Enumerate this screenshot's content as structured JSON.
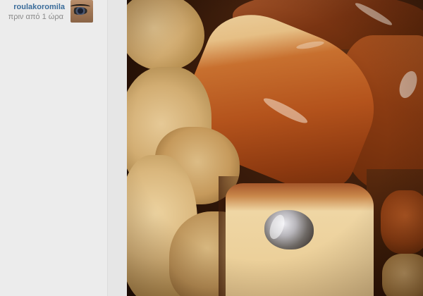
{
  "post": {
    "username": "roulakoromila",
    "timestamp": "πριν από 1 ώρα",
    "avatar_icon": "profile-photo",
    "photo_icon": "food-photo"
  },
  "colors": {
    "username": "#3a6c9a",
    "timestamp": "#8a8a8a",
    "sidebar_bg": "#ececec"
  }
}
